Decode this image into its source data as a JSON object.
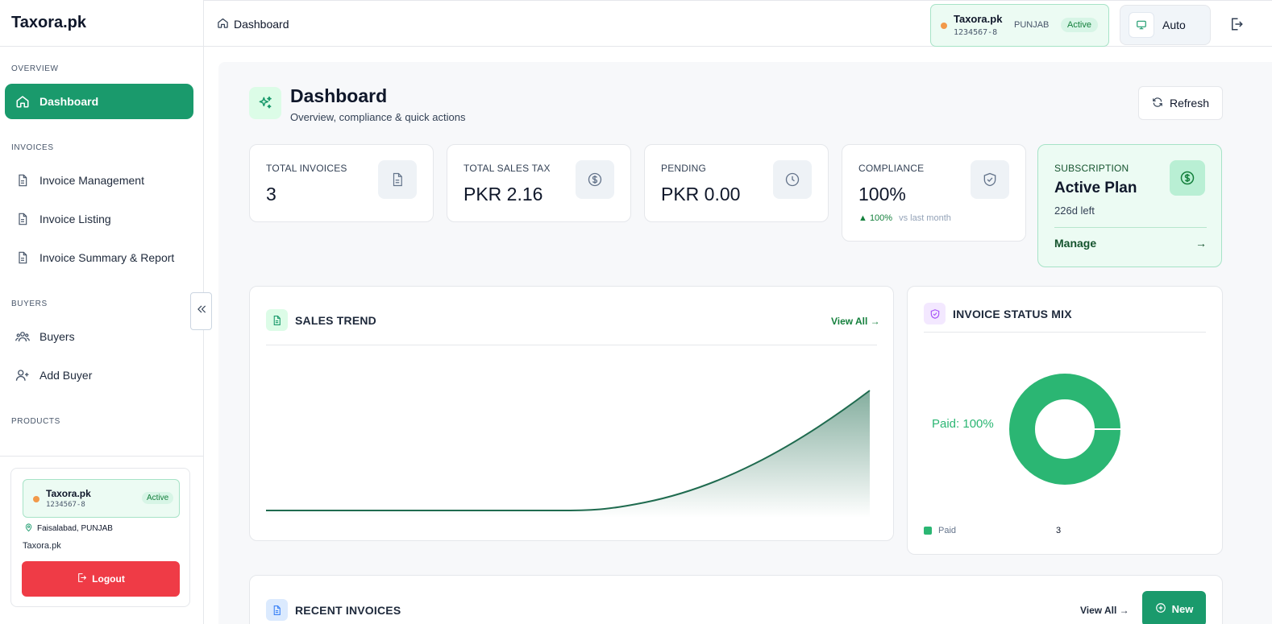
{
  "app": {
    "brand": "Taxora.pk"
  },
  "sidebar": {
    "sections": {
      "overview": "OVERVIEW",
      "invoices": "INVOICES",
      "buyers": "BUYERS",
      "products": "PRODUCTS"
    },
    "items": [
      {
        "label": "Dashboard",
        "icon": "home-icon",
        "active": true
      },
      {
        "label": "Invoice Management",
        "icon": "document-icon"
      },
      {
        "label": "Invoice Listing",
        "icon": "document-icon"
      },
      {
        "label": "Invoice Summary & Report",
        "icon": "document-icon"
      },
      {
        "label": "Buyers",
        "icon": "users-icon"
      },
      {
        "label": "Add Buyer",
        "icon": "user-plus-icon"
      }
    ],
    "company": {
      "name": "Taxora.pk",
      "ntn": "1234567-8",
      "status": "Active",
      "location": "Faisalabad, PUNJAB",
      "label": "Taxora.pk"
    },
    "logout_label": "Logout"
  },
  "topbar": {
    "breadcrumb": "Dashboard",
    "company": {
      "name": "Taxora.pk",
      "ntn": "1234567-8",
      "province": "PUNJAB",
      "status": "Active"
    },
    "theme_label": "Auto"
  },
  "page": {
    "title": "Dashboard",
    "subtitle": "Overview, compliance & quick actions",
    "refresh_label": "Refresh"
  },
  "stats": [
    {
      "label": "TOTAL INVOICES",
      "value": "3",
      "icon": "document-icon"
    },
    {
      "label": "TOTAL SALES TAX",
      "value": "PKR 2.16",
      "icon": "dollar-circle-icon"
    },
    {
      "label": "PENDING",
      "value": "PKR 0.00",
      "icon": "clock-icon"
    },
    {
      "label": "COMPLIANCE",
      "value": "100%",
      "icon": "shield-check-icon",
      "trend": "▲ 100%",
      "trend_note": "vs last month"
    }
  ],
  "subscription": {
    "label": "SUBSCRIPTION",
    "plan": "Active Plan",
    "remaining": "226d left",
    "manage_label": "Manage",
    "arrow": "→"
  },
  "sales_trend": {
    "title": "SALES TREND",
    "view_all": "View All →",
    "colors": {
      "line": "#1f6b4f",
      "fill": "#1f6b4f"
    }
  },
  "status_mix": {
    "title": "INVOICE STATUS MIX",
    "paid_label": "Paid: 100%",
    "legend": [
      {
        "label": "Paid",
        "count": "3",
        "color": "#2bb673"
      }
    ]
  },
  "recent_invoices": {
    "title": "RECENT INVOICES",
    "view_all": "View All →",
    "new_label": "New"
  },
  "colors": {
    "accent": "#1a9a6c",
    "danger": "#ef3b46",
    "mint": "#ecfbf3"
  }
}
